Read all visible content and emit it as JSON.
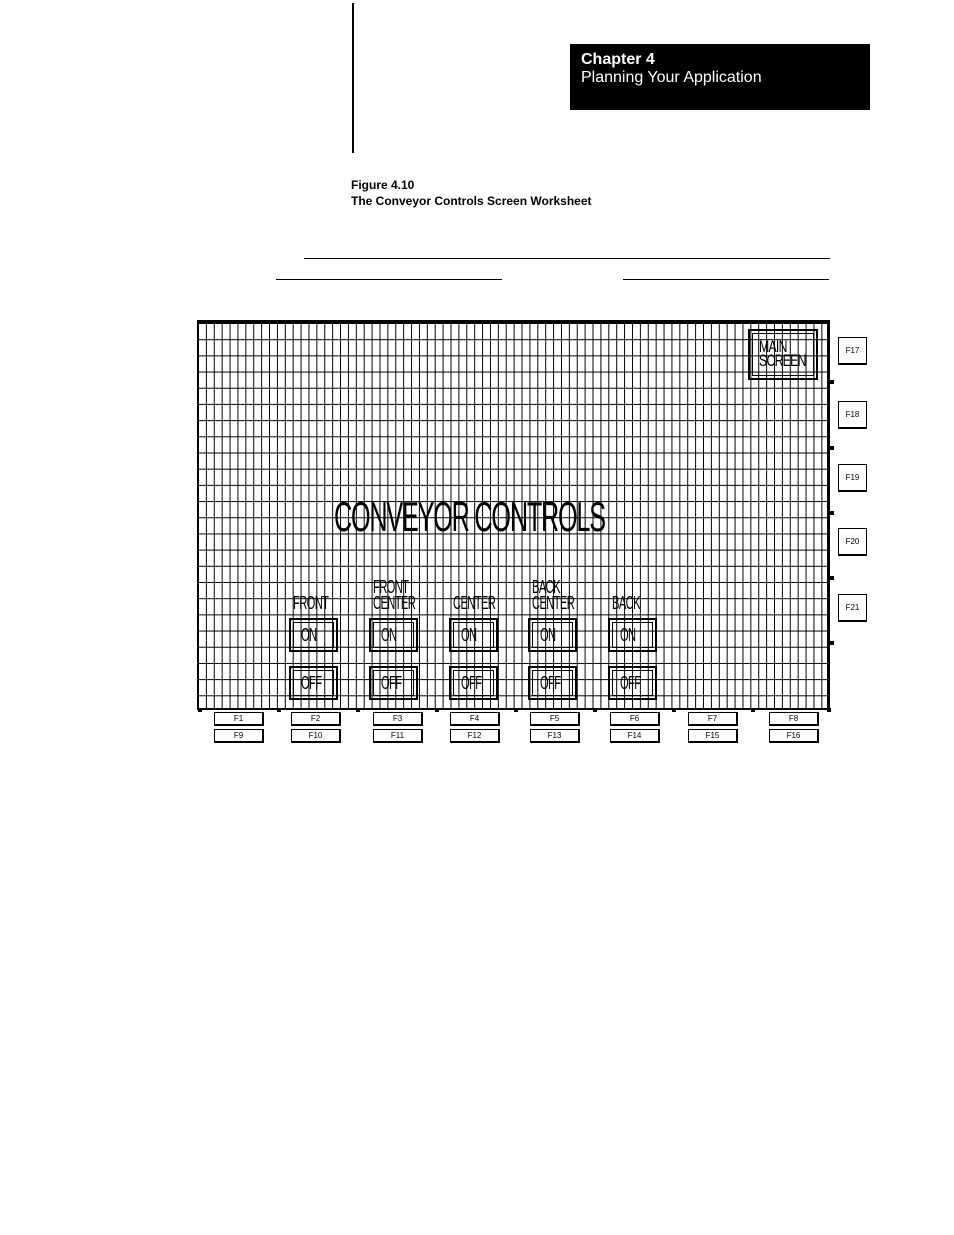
{
  "header": {
    "chapter": "Chapter 4",
    "section": "Planning Your Application"
  },
  "figure": {
    "number": "Figure 4.10",
    "caption": "The Conveyor Controls Screen Worksheet"
  },
  "screen": {
    "title": "CONVEYOR CONTROLS",
    "main_button": [
      "MAIN",
      "SCREEN"
    ],
    "conveyors": [
      {
        "label": [
          "",
          "FRONT"
        ],
        "on": "ON",
        "off": "OFF"
      },
      {
        "label": [
          "FRONT",
          "CENTER"
        ],
        "on": "ON",
        "off": "OFF"
      },
      {
        "label": [
          "",
          "CENTER"
        ],
        "on": "ON",
        "off": "OFF"
      },
      {
        "label": [
          "BACK",
          "CENTER"
        ],
        "on": "ON",
        "off": "OFF"
      },
      {
        "label": [
          "",
          "BACK"
        ],
        "on": "ON",
        "off": "OFF"
      }
    ]
  },
  "function_keys": {
    "top_row": [
      "F1",
      "F2",
      "F3",
      "F4",
      "F5",
      "F6",
      "F7",
      "F8"
    ],
    "bottom_row": [
      "F9",
      "F10",
      "F11",
      "F12",
      "F13",
      "F14",
      "F15",
      "F16"
    ],
    "right_column": [
      "F17",
      "F18",
      "F19",
      "F20",
      "F21"
    ]
  }
}
